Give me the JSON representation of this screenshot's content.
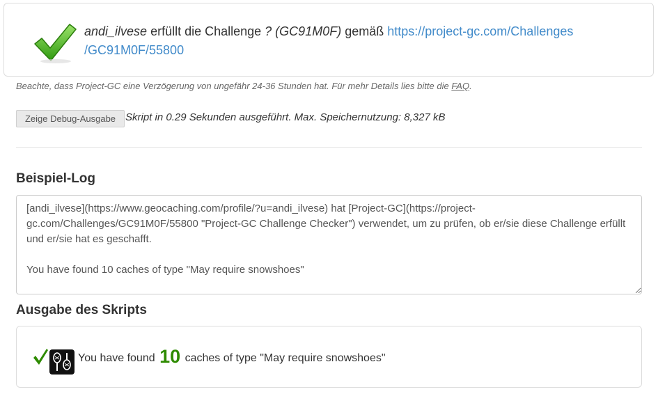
{
  "result": {
    "username": "andi_ilvese",
    "text_fulfills": " erfüllt die Challenge ",
    "challenge": "? (GC91M0F)",
    "text_according": " gemäß ",
    "link_text_line1": "https://project-gc.com/Challenges",
    "link_text_line2": "/GC91M0F/55800"
  },
  "note": {
    "text": "Beachte, dass Project-GC eine Verzögerung von ungefähr 24-36 Stunden hat. Für mehr Details lies bitte die ",
    "faq_label": "FAQ",
    "end": "."
  },
  "debug": {
    "button_label": "Zeige Debug-Ausgabe",
    "exec_info": "Skript in 0.29 Sekunden ausgeführt. Max. Speichernutzung: 8,327 kB"
  },
  "log": {
    "heading": "Beispiel-Log",
    "content": "[andi_ilvese](https://www.geocaching.com/profile/?u=andi_ilvese) hat [Project-GC](https://project-gc.com/Challenges/GC91M0F/55800 \"Project-GC Challenge Checker\") verwendet, um zu prüfen, ob er/sie diese Challenge erfüllt und er/sie hat es geschafft.\n\nYou have found 10 caches of type \"May require snowshoes\""
  },
  "output": {
    "heading": "Ausgabe des Skripts",
    "prefix": "You have found ",
    "count": "10",
    "suffix": " caches of type \"May require snowshoes\"",
    "icon": "snowshoes-icon",
    "check_color": "#2e8b00"
  }
}
